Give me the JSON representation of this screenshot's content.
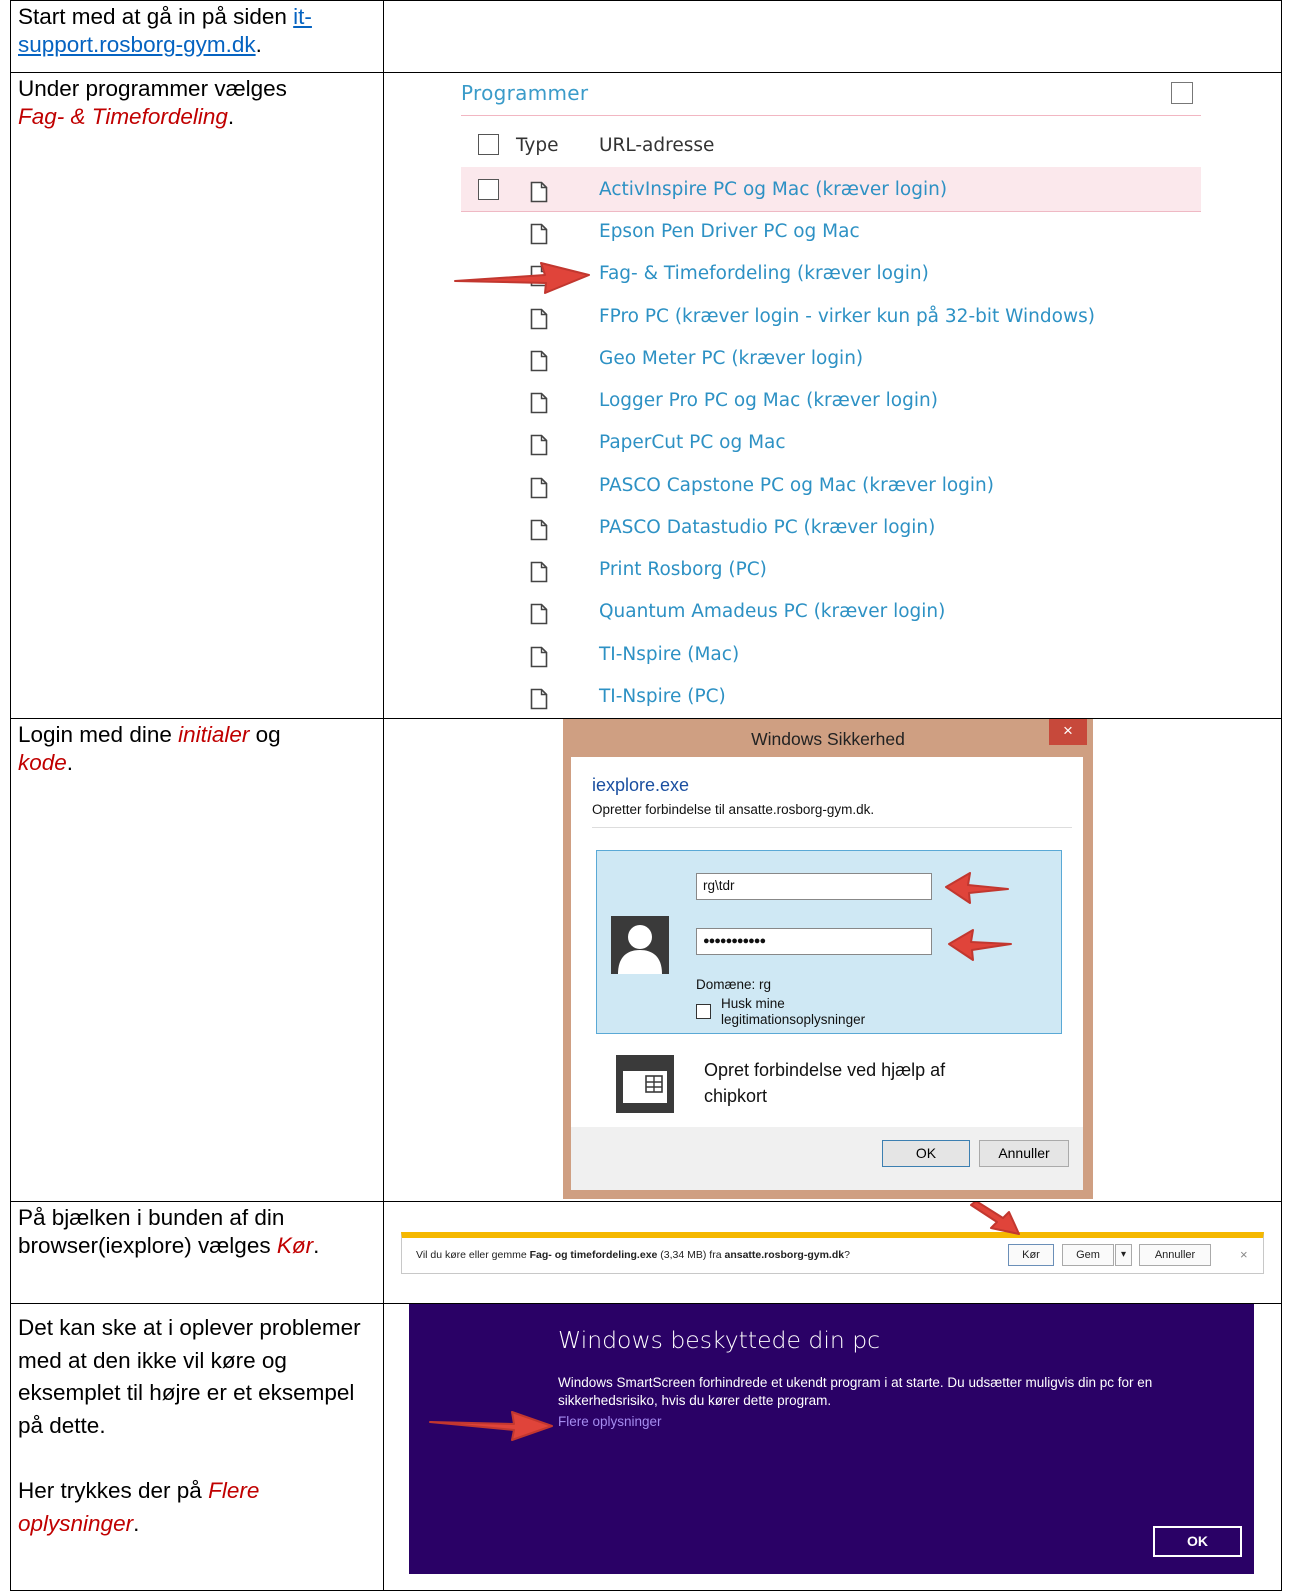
{
  "rows": [
    {
      "text_before": "Start med at gå in på siden ",
      "link_line1": "it-",
      "link_line2": "support.rosborg-gym.dk",
      "text_after": "."
    },
    {
      "text_before": "Under programmer vælges ",
      "emphasis": "Fag- & Timefordeling",
      "text_after": "."
    },
    {
      "text_before": "Login med dine ",
      "emphasis1": "initialer",
      "text_middle": " og ",
      "emphasis2": "kode",
      "text_after": "."
    },
    {
      "text_before": "På bjælken i bunden af din browser(iexplore) vælges ",
      "emphasis": "Kør",
      "text_after": "."
    },
    {
      "paragraph1": "Det kan ske at i oplever problemer med at den ikke vil køre og eksemplet til højre er et eksempel på dette.",
      "text_before": "Her trykkes der på ",
      "emphasis": "Flere oplysninger",
      "text_after": "."
    }
  ],
  "programmer": {
    "title": "Programmer",
    "col_type": "Type",
    "col_url": "URL-adresse",
    "items": [
      "ActivInspire PC og Mac (kræver login)",
      "Epson Pen Driver PC og Mac",
      "Fag- & Timefordeling (kræver login)",
      "FPro PC (kræver login - virker kun på 32-bit Windows)",
      "Geo Meter PC (kræver login)",
      "Logger Pro PC og Mac (kræver login)",
      "PaperCut PC og Mac",
      "PASCO Capstone PC og Mac (kræver login)",
      "PASCO Datastudio PC (kræver login)",
      "Print Rosborg (PC)",
      "Quantum Amadeus PC (kræver login)",
      "TI-Nspire (Mac)",
      "TI-Nspire (PC)"
    ]
  },
  "security_dialog": {
    "title": "Windows Sikkerhed",
    "close": "×",
    "app": "iexplore.exe",
    "subtitle": "Opretter forbindelse til ansatte.rosborg-gym.dk.",
    "username": "rg\\tdr",
    "password_mask": "●●●●●●●●●●●",
    "domain": "Domæne: rg",
    "remember": "Husk mine legitimationsoplysninger",
    "chipcard": "Opret forbindelse ved hjælp af chipkort",
    "ok": "OK",
    "cancel": "Annuller"
  },
  "download_bar": {
    "prefix": "Vil du køre eller gemme ",
    "filename": "Fag- og timefordeling.exe",
    "size": " (3,34 MB) fra ",
    "host": "ansatte.rosborg-gym.dk",
    "suffix": "?",
    "run": "Kør",
    "save": "Gem",
    "dropdown": "▾",
    "cancel": "Annuller",
    "close": "×"
  },
  "smartscreen": {
    "title": "Windows beskyttede din pc",
    "text": "Windows SmartScreen forhindrede et ukendt program i at starte. Du udsætter muligvis din pc for en sikkerhedsrisiko, hvis du kører dette program.",
    "more": "Flere oplysninger",
    "ok": "OK"
  },
  "colors": {
    "link": "#0563c1",
    "emphasis": "#c00000",
    "list_link": "#2d91c4",
    "arrow": "#e0443a",
    "smartscreen_bg": "#2a0166"
  }
}
